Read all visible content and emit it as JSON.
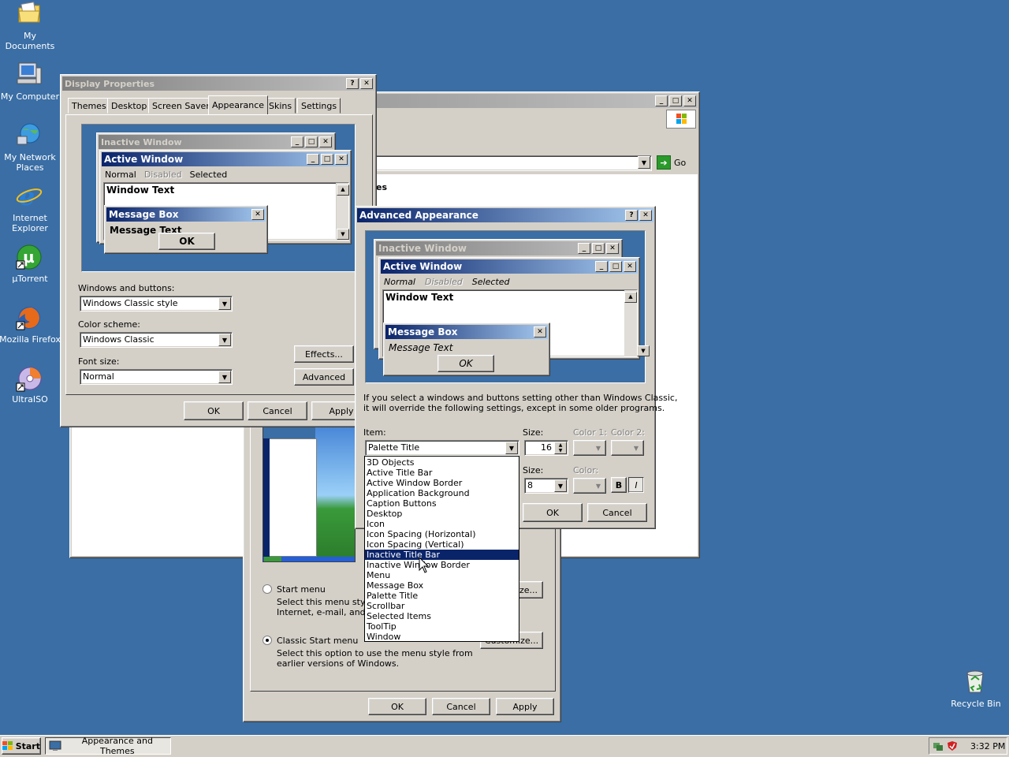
{
  "desktop": {
    "icons": [
      {
        "label1": "My Documents",
        "label2": ""
      },
      {
        "label1": "My Computer",
        "label2": ""
      },
      {
        "label1": "My Network",
        "label2": "Places"
      },
      {
        "label1": "Internet",
        "label2": "Explorer"
      },
      {
        "label1": "µTorrent",
        "label2": ""
      },
      {
        "label1": "Mozilla Firefox",
        "label2": ""
      },
      {
        "label1": "UltraISO",
        "label2": ""
      },
      {
        "label1": "Recycle Bin",
        "label2": ""
      }
    ]
  },
  "explorer": {
    "address_go": "Go",
    "partial_text": "es"
  },
  "taskbar": {
    "start": "Start",
    "task": "Appearance and Themes",
    "clock": "3:32 PM"
  },
  "display_properties": {
    "title": "Display Properties",
    "tabs": [
      "Themes",
      "Desktop",
      "Screen Saver",
      "Appearance",
      "Skins",
      "Settings"
    ],
    "preview": {
      "inactive_title": "Inactive Window",
      "active_title": "Active Window",
      "menu": [
        "Normal",
        "Disabled",
        "Selected"
      ],
      "window_text": "Window Text",
      "msgbox_title": "Message Box",
      "msgbox_text": "Message Text",
      "ok": "OK"
    },
    "windows_buttons_label": "Windows and buttons:",
    "windows_buttons_value": "Windows Classic style",
    "color_scheme_label": "Color scheme:",
    "color_scheme_value": "Windows Classic",
    "font_size_label": "Font size:",
    "font_size_value": "Normal",
    "effects_button": "Effects...",
    "advanced_button": "Advanced",
    "ok": "OK",
    "cancel": "Cancel",
    "apply": "Apply"
  },
  "taskbar_props": {
    "start_menu_label": "Start menu",
    "start_menu_desc1": "Select this menu style fo",
    "start_menu_desc2": "Internet, e-mail, and you",
    "classic_label": "Classic Start menu",
    "classic_desc1": "Select this option to use the menu style from",
    "classic_desc2": "earlier versions of Windows.",
    "customize_button": "Customize...",
    "customize_partial": "ze...",
    "ok": "OK",
    "cancel": "Cancel",
    "apply": "Apply"
  },
  "advanced_appearance": {
    "title": "Advanced Appearance",
    "preview": {
      "inactive_title": "Inactive Window",
      "active_title": "Active Window",
      "menu": [
        "Normal",
        "Disabled",
        "Selected"
      ],
      "window_text": "Window Text",
      "msgbox_title": "Message Box",
      "msgbox_text": "Message Text",
      "ok": "OK"
    },
    "info1": "If you select a windows and buttons setting other than Windows Classic,",
    "info2": "it will override the following settings, except in some older programs.",
    "item_label": "Item:",
    "item_value": "Palette Title",
    "size_label": "Size:",
    "size_value": "16",
    "color1_label": "Color 1:",
    "color2_label": "Color 2:",
    "font_size_label": "Size:",
    "font_size_value": "8",
    "font_color_label": "Color:",
    "bold": "B",
    "italic": "I",
    "ok": "OK",
    "cancel": "Cancel",
    "dropdown_items": [
      "3D Objects",
      "Active Title Bar",
      "Active Window Border",
      "Application Background",
      "Caption Buttons",
      "Desktop",
      "Icon",
      "Icon Spacing (Horizontal)",
      "Icon Spacing (Vertical)",
      "Inactive Title Bar",
      "Inactive Window Border",
      "Menu",
      "Message Box",
      "Palette Title",
      "Scrollbar",
      "Selected Items",
      "ToolTip",
      "Window"
    ],
    "selected_index": 9
  },
  "colors": {
    "desktop": "#3a6ea5",
    "active_title": "#0a246a",
    "face": "#d4d0c8"
  }
}
